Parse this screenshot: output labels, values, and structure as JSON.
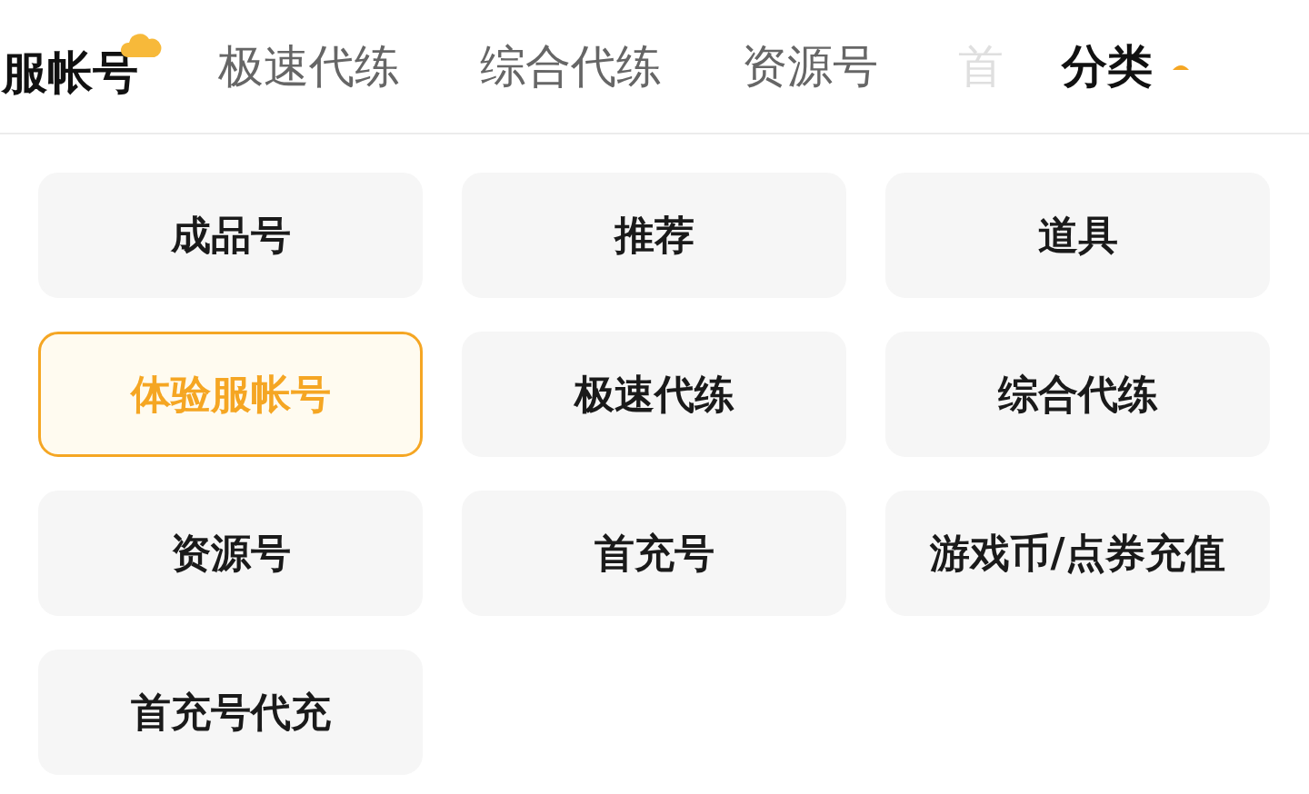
{
  "tabs": [
    {
      "label": "服帐号",
      "selected": true
    },
    {
      "label": "极速代练",
      "selected": false
    },
    {
      "label": "综合代练",
      "selected": false
    },
    {
      "label": "资源号",
      "selected": false
    },
    {
      "label": "首",
      "selected": false,
      "faded": true
    }
  ],
  "category_toggle": {
    "label": "分类",
    "expanded": true
  },
  "categories": [
    {
      "label": "成品号",
      "selected": false
    },
    {
      "label": "推荐",
      "selected": false
    },
    {
      "label": "道具",
      "selected": false
    },
    {
      "label": "体验服帐号",
      "selected": true
    },
    {
      "label": "极速代练",
      "selected": false
    },
    {
      "label": "综合代练",
      "selected": false
    },
    {
      "label": "资源号",
      "selected": false
    },
    {
      "label": "首充号",
      "selected": false
    },
    {
      "label": "游戏币/点券充值",
      "selected": false
    },
    {
      "label": "首充号代充",
      "selected": false
    }
  ]
}
